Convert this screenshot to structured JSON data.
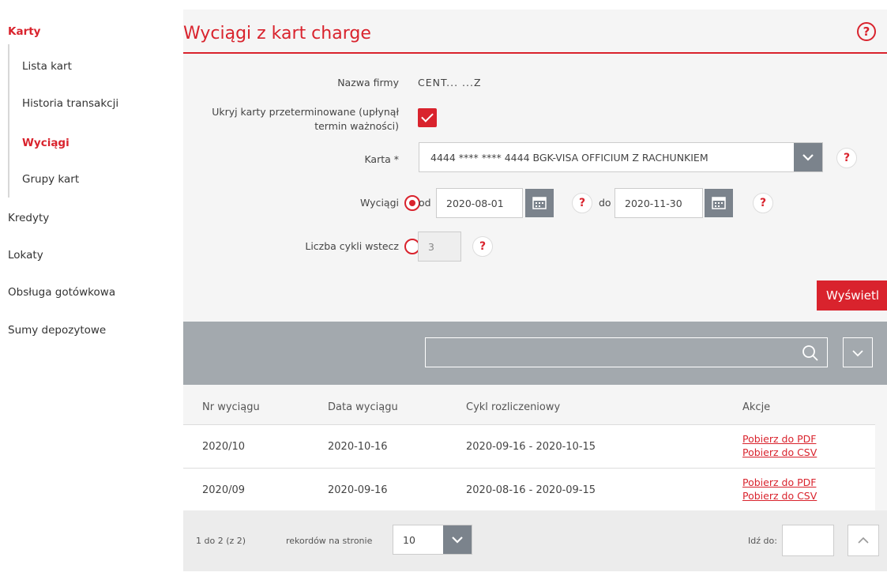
{
  "sidebar": {
    "karty": "Karty",
    "sub": [
      "Lista kart",
      "Historia transakcji",
      "Wyciągi",
      "Grupy kart"
    ],
    "kredyty": "Kredyty",
    "lokaty": "Lokaty",
    "obsluga": "Obsługa gotówkowa",
    "sumy": "Sumy depozytowe"
  },
  "page": {
    "title": "Wyciągi z kart charge",
    "help": "?"
  },
  "form": {
    "company_label": "Nazwa firmy",
    "company_value": "CENT... ...Z",
    "hide_label_1": "Ukryj karty przeterminowane (upłynął",
    "hide_label_2": "termin ważności)",
    "card_label": "Karta *",
    "card_value": "4444 **** **** 4444 BGK-VISA OFFICIUM Z RACHUNKIEM",
    "statements_label": "Wyciągi",
    "from_label": "od",
    "from_date": "2020-08-01",
    "to_label": "do",
    "to_date": "2020-11-30",
    "cycles_label": "Liczba cykli wstecz",
    "cycles_value": "3",
    "submit": "Wyświetl"
  },
  "table": {
    "headers": [
      "Nr wyciągu",
      "Data wyciągu",
      "Cykl rozliczeniowy",
      "Akcje"
    ],
    "rows": [
      {
        "nr": "2020/10",
        "date": "2020-10-16",
        "cycle": "2020-09-16 - 2020-10-15",
        "pdf": "Pobierz do PDF",
        "csv": "Pobierz do CSV"
      },
      {
        "nr": "2020/09",
        "date": "2020-09-16",
        "cycle": "2020-08-16 - 2020-09-15",
        "pdf": "Pobierz do PDF",
        "csv": "Pobierz do CSV"
      }
    ]
  },
  "footer": {
    "range": "1 do 2 (z 2)",
    "per_page_label": "rekordów na stronie",
    "per_page_value": "10",
    "goto_label": "Idź do:"
  },
  "colors": {
    "accent": "#d9232d",
    "panel": "#f5f5f5",
    "filter_bar": "#a3a9ae",
    "button_gray": "#7b838c"
  }
}
